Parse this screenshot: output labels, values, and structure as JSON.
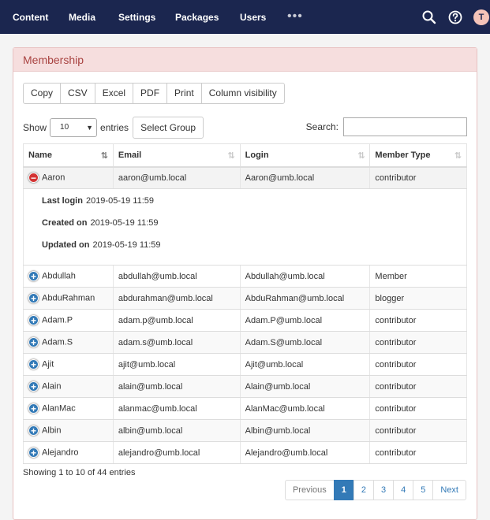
{
  "nav": {
    "items": [
      "Content",
      "Media",
      "Settings",
      "Packages",
      "Users"
    ],
    "more": "•••",
    "avatar_initial": "T"
  },
  "panel": {
    "title": "Membership"
  },
  "export_buttons": [
    "Copy",
    "CSV",
    "Excel",
    "PDF",
    "Print",
    "Column visibility"
  ],
  "length_control": {
    "show_label": "Show",
    "value": "10",
    "entries_label": "entries"
  },
  "select_group_label": "Select Group",
  "search": {
    "label": "Search:",
    "value": ""
  },
  "table": {
    "headers": [
      "Name",
      "Email",
      "Login",
      "Member Type"
    ],
    "expanded_row": {
      "name": "Aaron",
      "email": "aaron@umb.local",
      "login": "Aaron@umb.local",
      "type": "contributor",
      "details": [
        {
          "title": "Last login",
          "value": "2019-05-19 11:59"
        },
        {
          "title": "Created on",
          "value": "2019-05-19 11:59"
        },
        {
          "title": "Updated on",
          "value": "2019-05-19 11:59"
        }
      ]
    },
    "rows": [
      {
        "name": "Abdullah",
        "email": "abdullah@umb.local",
        "login": "Abdullah@umb.local",
        "type": "Member"
      },
      {
        "name": "AbduRahman",
        "email": "abdurahman@umb.local",
        "login": "AbduRahman@umb.local",
        "type": "blogger"
      },
      {
        "name": "Adam.P",
        "email": "adam.p@umb.local",
        "login": "Adam.P@umb.local",
        "type": "contributor"
      },
      {
        "name": "Adam.S",
        "email": "adam.s@umb.local",
        "login": "Adam.S@umb.local",
        "type": "contributor"
      },
      {
        "name": "Ajit",
        "email": "ajit@umb.local",
        "login": "Ajit@umb.local",
        "type": "contributor"
      },
      {
        "name": "Alain",
        "email": "alain@umb.local",
        "login": "Alain@umb.local",
        "type": "contributor"
      },
      {
        "name": "AlanMac",
        "email": "alanmac@umb.local",
        "login": "AlanMac@umb.local",
        "type": "contributor"
      },
      {
        "name": "Albin",
        "email": "albin@umb.local",
        "login": "Albin@umb.local",
        "type": "contributor"
      },
      {
        "name": "Alejandro",
        "email": "alejandro@umb.local",
        "login": "Alejandro@umb.local",
        "type": "contributor"
      }
    ]
  },
  "info": "Showing 1 to 10 of 44 entries",
  "pagination": {
    "previous": "Previous",
    "pages": [
      "1",
      "2",
      "3",
      "4",
      "5"
    ],
    "active": "1",
    "next": "Next"
  }
}
